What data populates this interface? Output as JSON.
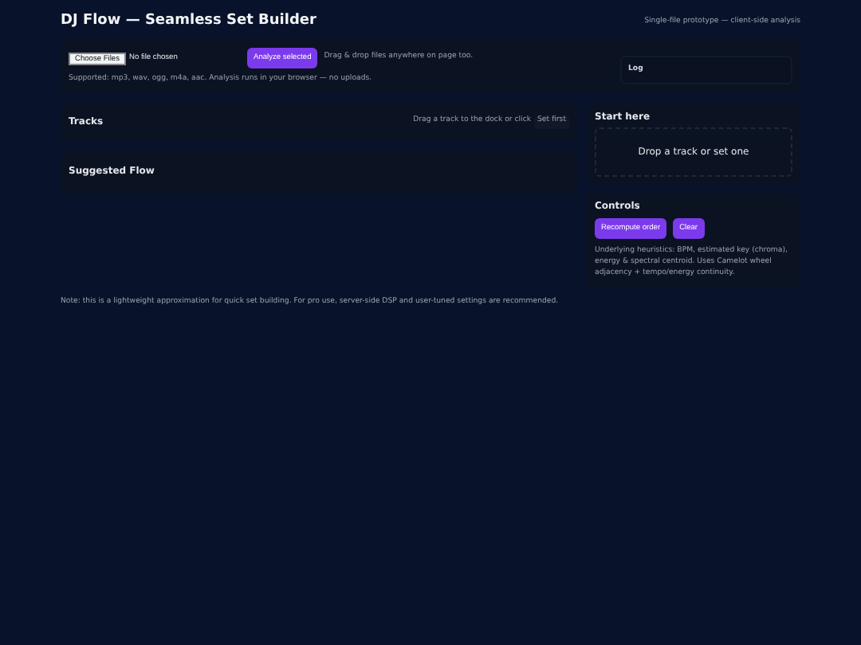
{
  "header": {
    "title": "DJ Flow — Seamless Set Builder",
    "subtitle": "Single-file prototype — client-side analysis"
  },
  "upload": {
    "choose_button": "Choose Files",
    "file_status": "No file chosen",
    "analyze_button": "Analyze selected",
    "hint": "Drag & drop files anywhere on page too.",
    "supported": "Supported: mp3, wav, ogg, m4a, aac. Analysis runs in your browser — no uploads.",
    "log_title": "Log"
  },
  "tracks": {
    "title": "Tracks",
    "hint": "Drag a track to the dock or click",
    "set_first_button": "Set first"
  },
  "suggested_flow": {
    "title": "Suggested Flow"
  },
  "start_here": {
    "title": "Start here",
    "dropzone": "Drop a track or set one"
  },
  "controls": {
    "title": "Controls",
    "buttons": [
      "Recompute order",
      "Clear"
    ],
    "description": "Underlying heuristics: BPM, estimated key (chroma), energy & spectral centroid. Uses Camelot wheel adjacency + tempo/energy continuity."
  },
  "note": "Note: this is a lightweight approximation for quick set building. For pro use, server-side DSP and user-tuned settings are recommended."
}
